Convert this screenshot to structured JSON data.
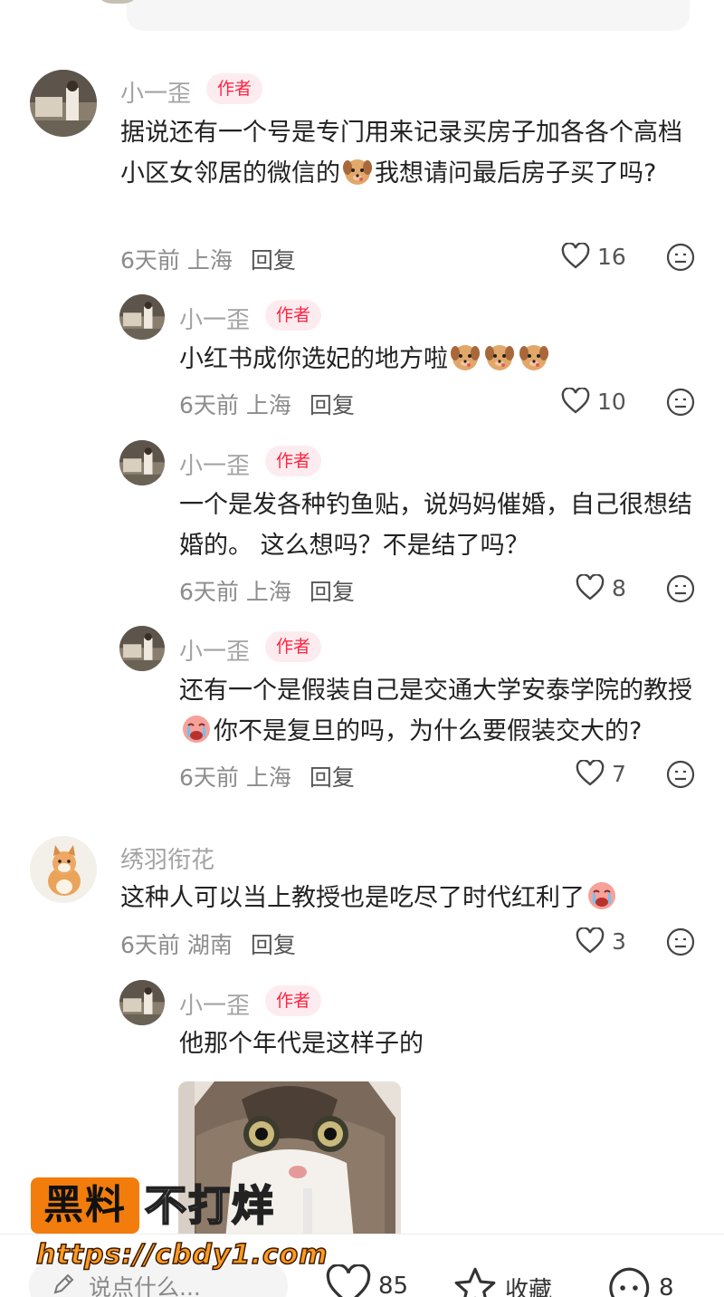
{
  "comments": [
    {
      "name": "小一歪",
      "badge": "作者",
      "text_parts": [
        "据说还有一个号是专门用来记录买房子加各各个高档小区女邻居的微信的",
        "我想请问最后房子买了吗?"
      ],
      "emoji": "dog-emoji",
      "time": "6天前",
      "location": "上海",
      "reply_label": "回复",
      "likes": "16"
    },
    {
      "name": "小一歪",
      "badge": "作者",
      "text": "小红书成你选妃的地方啦",
      "emojis": [
        "dog-emoji",
        "dog-emoji",
        "dog-emoji"
      ],
      "time": "6天前",
      "location": "上海",
      "reply_label": "回复",
      "likes": "10"
    },
    {
      "name": "小一歪",
      "badge": "作者",
      "text": "一个是发各种钓鱼贴，说妈妈催婚，自己很想结婚的。 这么想吗？不是结了吗？",
      "time": "6天前",
      "location": "上海",
      "reply_label": "回复",
      "likes": "8"
    },
    {
      "name": "小一歪",
      "badge": "作者",
      "text_parts": [
        "还有一个是假装自己是交通大学安泰学院的教授",
        "你不是复旦的吗，为什么要假装交大的?"
      ],
      "emoji": "crying-face-emoji",
      "time": "6天前",
      "location": "上海",
      "reply_label": "回复",
      "likes": "7"
    },
    {
      "name": "绣羽衔花",
      "text": "这种人可以当上教授也是吃尽了时代红利了",
      "emoji": "crying-face-emoji",
      "time": "6天前",
      "location": "湖南",
      "reply_label": "回复",
      "likes": "3"
    },
    {
      "name": "小一歪",
      "badge": "作者",
      "text": "他那个年代是这样子的",
      "image": "cat-photo"
    }
  ],
  "watermark": {
    "box_text": "黑料",
    "text": "不打烊",
    "url": "https://cbdy1.com"
  },
  "bottom_bar": {
    "input_placeholder": "说点什么...",
    "likes": "85",
    "collect_label": "收藏",
    "comments": "8"
  },
  "colors": {
    "accent": "#ff2442",
    "badge_bg": "#fdecef",
    "watermark_orange": "#f27d0c"
  }
}
